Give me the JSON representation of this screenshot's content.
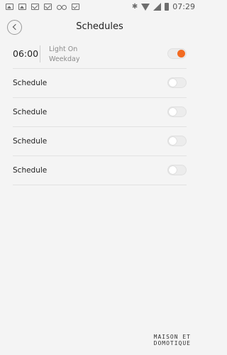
{
  "status_bar": {
    "left_icons": [
      "image-icon",
      "image-icon",
      "mail-icon",
      "mail-icon",
      "voicemail-icon",
      "check-icon"
    ],
    "bluetooth": "✱",
    "time": "07:29"
  },
  "header": {
    "title": "Schedules",
    "back_icon": "chevron-left-icon"
  },
  "schedules": [
    {
      "time": "06:00",
      "action": "Light On",
      "repeat": "Weekday",
      "enabled": true
    },
    {
      "label": "Schedule",
      "enabled": false
    },
    {
      "label": "Schedule",
      "enabled": false
    },
    {
      "label": "Schedule",
      "enabled": false
    },
    {
      "label": "Schedule",
      "enabled": false
    }
  ],
  "watermark": {
    "line1": "MAISON ET",
    "line2": "DOMOTIQUE"
  },
  "colors": {
    "accent": "#f26a21",
    "background": "#f4f4f4",
    "divider": "#e2e2e2"
  }
}
